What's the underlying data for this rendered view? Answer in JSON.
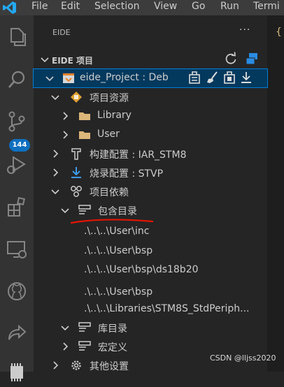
{
  "menubar": {
    "items": [
      "File",
      "Edit",
      "Selection",
      "View",
      "Go",
      "Run",
      "Termi"
    ]
  },
  "activity": {
    "source_control_badge": "144"
  },
  "sidebar": {
    "header_title": "EIDE",
    "more_label": "···",
    "section_title": "EIDE 项目",
    "project_label": "eide_Project : Deb",
    "tree": {
      "project_resources": "项目资源",
      "library": "Library",
      "user": "User",
      "build_config": "构建配置 : IAR_STM8",
      "flash_config": "烧录配置 : STVP",
      "dependencies": "项目依赖",
      "include_dirs": "包含目录",
      "include_paths": [
        ".\\..\\..\\User\\inc",
        ".\\..\\..\\User\\bsp",
        ".\\..\\..\\User\\bsp\\ds18b20",
        ".\\..\\..\\User\\bsp",
        ".\\..\\..\\Libraries\\STM8S_StdPeriph..."
      ],
      "lib_dirs": "库目录",
      "macros": "宏定义",
      "other_settings": "其他设置"
    }
  },
  "editor": {
    "bracket_text": "{"
  },
  "watermark": "CSDN @lljss2020",
  "colors": {
    "accent": "#007fd4",
    "badge": "#0e70c0",
    "folder": "#dcb67a",
    "annotation_red": "#e51400"
  }
}
